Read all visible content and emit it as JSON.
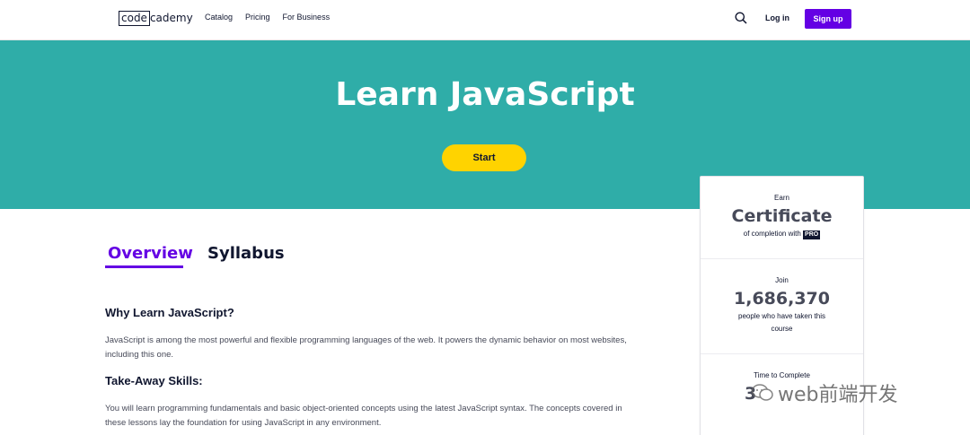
{
  "header": {
    "logo_box": "code",
    "logo_rest": "cademy",
    "nav": [
      "Catalog",
      "Pricing",
      "For Business"
    ],
    "search_icon": "search-icon",
    "login": "Log in",
    "signup": "Sign up",
    "signup_color": "#6400e4"
  },
  "hero": {
    "title": "Learn JavaScript",
    "start": "Start",
    "bg_color": "#2fada8",
    "button_color": "#ffd300"
  },
  "card": {
    "s1": {
      "label": "Earn",
      "value": "Certificate",
      "sub": "of completion with",
      "badge": "PRO"
    },
    "s2": {
      "label": "Join",
      "value": "1,686,370",
      "sub_line1": "people who have taken this",
      "sub_line2": "course"
    },
    "s3": {
      "label": "Time to Complete",
      "value": "3"
    }
  },
  "tabs": {
    "overview": "Overview",
    "syllabus": "Syllabus"
  },
  "content": {
    "why_heading": "Why Learn JavaScript?",
    "why_text": "JavaScript is among the most powerful and flexible programming languages of the web. It powers the dynamic behavior on most websites, including this one.",
    "skills_heading": "Take-Away Skills:",
    "skills_text": "You will learn programming fundamentals and basic object-oriented concepts using the latest JavaScript syntax. The concepts covered in these lessons lay the foundation for using JavaScript in any environment."
  },
  "watermark": {
    "text": "web前端开发",
    "icon": "wechat-icon"
  }
}
